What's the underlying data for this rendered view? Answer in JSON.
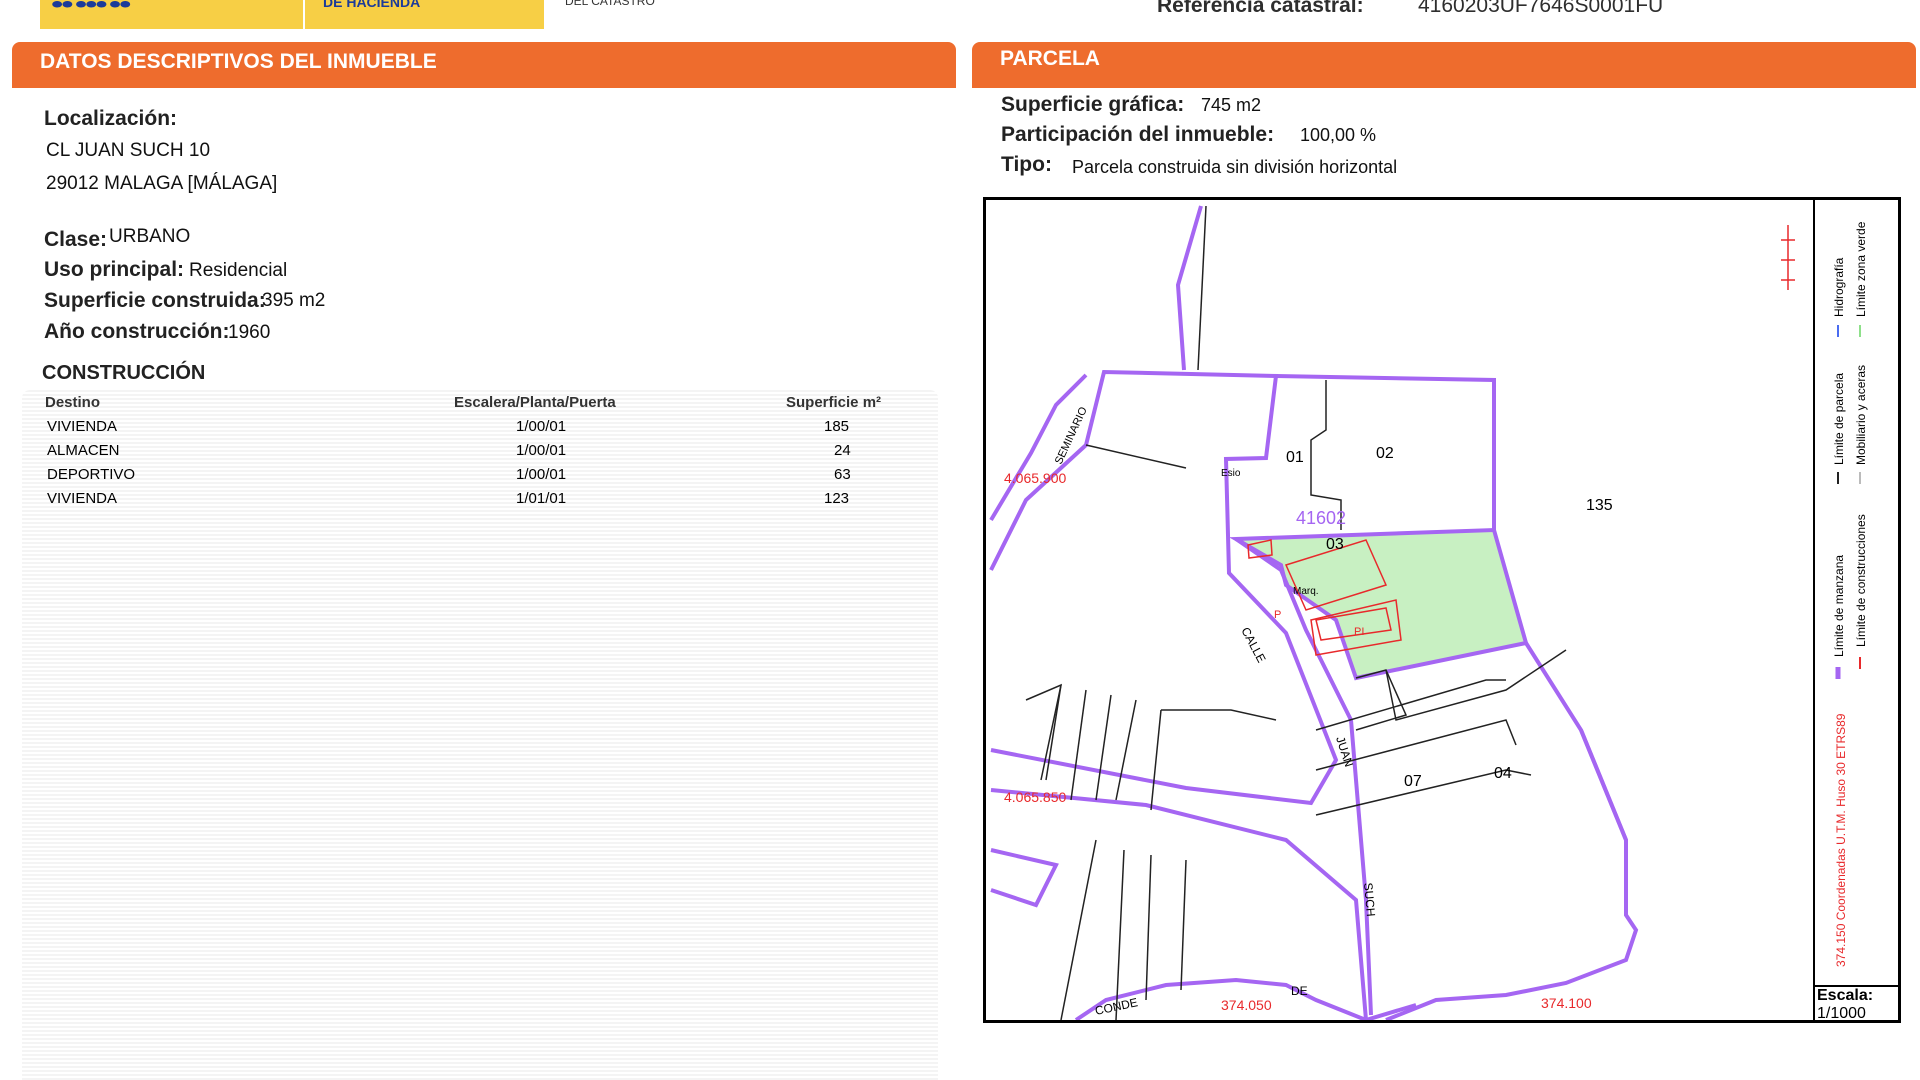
{
  "header": {
    "logo_text": "DE HACIENDA",
    "logo_sub": "DEL CATASTRO",
    "ref_label": "Referencia catastral:",
    "ref_value": "4160203UF7646S0001FU"
  },
  "left": {
    "title": "DATOS DESCRIPTIVOS DEL INMUEBLE",
    "localizacion_label": "Localización:",
    "address_line1": "CL JUAN SUCH 10",
    "address_line2": "29012 MALAGA [MÁLAGA]",
    "clase_label": "Clase:",
    "clase_value": "URBANO",
    "uso_label": "Uso principal:",
    "uso_value": "Residencial",
    "sup_label": "Superficie construida:",
    "sup_value": "395 m2",
    "anio_label": "Año construcción:",
    "anio_value": "1960",
    "construccion_title": "CONSTRUCCIÓN",
    "table": {
      "headers": [
        "Destino",
        "Escalera/Planta/Puerta",
        "Superficie m²"
      ],
      "rows": [
        [
          "VIVIENDA",
          "1/00/01",
          "185"
        ],
        [
          "ALMACEN",
          "1/00/01",
          "24"
        ],
        [
          "DEPORTIVO",
          "1/00/01",
          "63"
        ],
        [
          "VIVIENDA",
          "1/01/01",
          "123"
        ]
      ]
    }
  },
  "right": {
    "title": "PARCELA",
    "sup_grafica_label": "Superficie gráfica:",
    "sup_grafica_value": "745 m2",
    "participacion_label": "Participación del inmueble:",
    "participacion_value": "100,00 %",
    "tipo_label": "Tipo:",
    "tipo_value": "Parcela construida sin división horizontal"
  },
  "map": {
    "parcel_number": "41602",
    "labels": [
      "01",
      "02",
      "03",
      "04",
      "07",
      "135"
    ],
    "street_calle": "CALLE",
    "street_juan": "JUAN",
    "street_such": "SUCH",
    "street_seminario": "SEMINARIO",
    "street_conde": "CONDE",
    "street_de": "DE",
    "coord_1": "4.065.900",
    "coord_2": "4.065.850",
    "coord_3": "374.050",
    "coord_4": "374.100",
    "marq": "Marq.",
    "escalo": "Esio",
    "pi": "PI",
    "p": "P",
    "colors": {
      "manzana": "#a566f2",
      "parcela_fill": "#c8f0c2",
      "construcciones": "#e8292b",
      "numbers": "#2233dd",
      "coords": "#e8292b"
    },
    "legend": [
      "Límite de manzana",
      "Límite de parcela",
      "Hidrografía",
      "Límite de construcciones",
      "Mobiliario y aceras",
      "Límite zona verde"
    ],
    "utm": "374.150 Coordenadas U.T.M. Huso 30 ETRS89",
    "escala_label": "Escala:",
    "escala_value": "1/1000"
  }
}
